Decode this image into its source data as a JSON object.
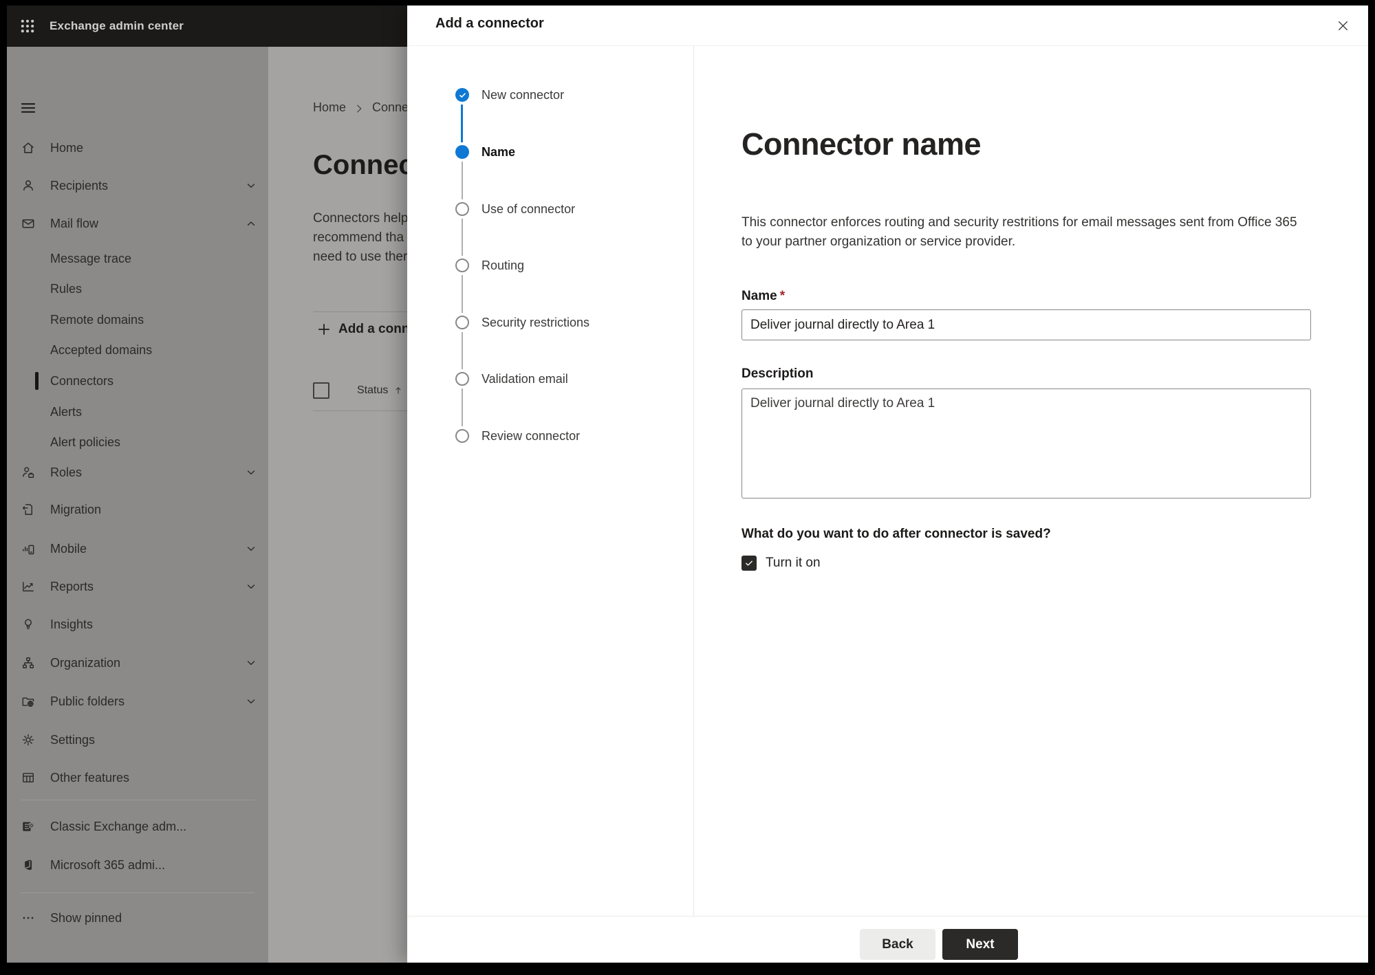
{
  "app": {
    "top_bar_title": "Exchange admin center"
  },
  "breadcrumb": {
    "home": "Home",
    "current": "Conne"
  },
  "page": {
    "title": "Connec",
    "intro_lines": {
      "l1": "Connectors help",
      "l2": "recommend tha",
      "l3": "need to use ther"
    },
    "add_connector_button": "Add a conn",
    "status_header": "Status"
  },
  "sidebar": {
    "items": [
      {
        "label": "Home",
        "icon": "home"
      },
      {
        "label": "Recipients",
        "icon": "person",
        "chevron": "down"
      },
      {
        "label": "Mail flow",
        "icon": "mail",
        "chevron": "up",
        "expanded": true
      },
      {
        "label": "Message trace",
        "sub": true
      },
      {
        "label": "Rules",
        "sub": true
      },
      {
        "label": "Remote domains",
        "sub": true
      },
      {
        "label": "Accepted domains",
        "sub": true
      },
      {
        "label": "Connectors",
        "sub": true,
        "selected": true
      },
      {
        "label": "Alerts",
        "sub": true
      },
      {
        "label": "Alert policies",
        "sub": true
      },
      {
        "label": "Roles",
        "icon": "person-badge",
        "chevron": "down"
      },
      {
        "label": "Migration",
        "icon": "document-arrow"
      },
      {
        "label": "Mobile",
        "icon": "mobile-chart",
        "chevron": "down"
      },
      {
        "label": "Reports",
        "icon": "line-chart",
        "chevron": "down"
      },
      {
        "label": "Insights",
        "icon": "lightbulb"
      },
      {
        "label": "Organization",
        "icon": "org-chart",
        "chevron": "down"
      },
      {
        "label": "Public folders",
        "icon": "folder-globe",
        "chevron": "down"
      },
      {
        "label": "Settings",
        "icon": "gear"
      },
      {
        "label": "Other features",
        "icon": "table-grid"
      },
      {
        "label": "Classic Exchange adm...",
        "icon": "exchange-logo"
      },
      {
        "label": "Microsoft 365 admi...",
        "icon": "office-logo"
      },
      {
        "label": "Show pinned",
        "icon": "ellipsis"
      }
    ]
  },
  "dialog": {
    "title": "Add a connector",
    "steps": [
      {
        "label": "New connector",
        "state": "completed"
      },
      {
        "label": "Name",
        "state": "current"
      },
      {
        "label": "Use of connector",
        "state": "upcoming"
      },
      {
        "label": "Routing",
        "state": "upcoming"
      },
      {
        "label": "Security restrictions",
        "state": "upcoming"
      },
      {
        "label": "Validation email",
        "state": "upcoming"
      },
      {
        "label": "Review connector",
        "state": "upcoming"
      }
    ],
    "content": {
      "heading": "Connector name",
      "description": "This connector enforces routing and security restritions for email messages sent from Office 365 to your partner organization or service provider.",
      "name_label": "Name",
      "required_mark": "*",
      "name_value": "Deliver journal directly to Area 1",
      "description_label": "Description",
      "description_value": "Deliver journal directly to Area 1",
      "after_save_question": "What do you want to do after connector is saved?",
      "turn_on_label": "Turn it on",
      "turn_on_checked": true
    },
    "footer": {
      "back": "Back",
      "next": "Next"
    }
  },
  "colors": {
    "accent_blue": "#0f78d4",
    "required_red": "#a4262c",
    "topbar": "#1b1a19"
  }
}
